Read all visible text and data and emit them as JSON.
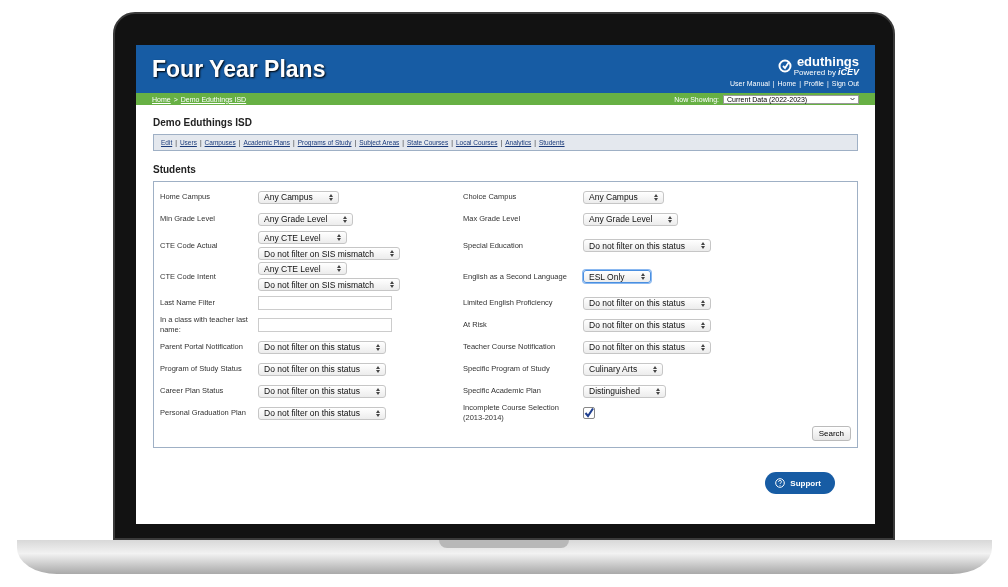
{
  "header": {
    "title": "Four Year Plans",
    "logo": {
      "name": "eduthings",
      "tagline": "Powered by",
      "brand": "iCEV"
    },
    "links_separator": "|",
    "links": [
      "User Manual",
      "Home",
      "Profile",
      "Sign Out"
    ]
  },
  "breadcrumb": {
    "separator": ">",
    "items": [
      "Home",
      "Demo Eduthings ISD"
    ]
  },
  "now_showing": {
    "label": "Now Showing:",
    "value": "Current Data (2022-2023)"
  },
  "district": "Demo Eduthings ISD",
  "nav": {
    "separator": "|",
    "links": [
      "Edit",
      "Users",
      "Campuses",
      "Academic Plans",
      "Programs of Study",
      "Subject Areas",
      "State Courses",
      "Local Courses",
      "Analytics",
      "Students"
    ]
  },
  "section_title": "Students",
  "filters": [
    {
      "left": {
        "label": "Home Campus",
        "kind": "select",
        "selects": [
          {
            "value": "Any Campus",
            "focused": false
          }
        ]
      },
      "right": {
        "label": "Choice Campus",
        "kind": "select",
        "selects": [
          {
            "value": "Any Campus",
            "focused": false
          }
        ]
      }
    },
    {
      "left": {
        "label": "Min Grade Level",
        "kind": "select",
        "selects": [
          {
            "value": "Any Grade Level",
            "focused": false
          }
        ]
      },
      "right": {
        "label": "Max Grade Level",
        "kind": "select",
        "selects": [
          {
            "value": "Any Grade Level",
            "focused": false
          }
        ]
      }
    },
    {
      "left": {
        "label": "CTE Code Actual",
        "kind": "select",
        "selects": [
          {
            "value": "Any CTE Level",
            "focused": false
          },
          {
            "value": "Do not filter on SIS mismatch",
            "focused": false
          }
        ]
      },
      "right": {
        "label": "Special Education",
        "kind": "select",
        "selects": [
          {
            "value": "Do not filter on this status",
            "focused": false
          }
        ]
      }
    },
    {
      "left": {
        "label": "CTE Code Intent",
        "kind": "select",
        "selects": [
          {
            "value": "Any CTE Level",
            "focused": false
          },
          {
            "value": "Do not filter on SIS mismatch",
            "focused": false
          }
        ]
      },
      "right": {
        "label": "English as a Second Language",
        "kind": "select",
        "selects": [
          {
            "value": "ESL Only",
            "focused": true
          }
        ]
      }
    },
    {
      "left": {
        "label": "Last Name Filter",
        "kind": "input"
      },
      "right": {
        "label": "Limited English Proficiency",
        "kind": "select",
        "selects": [
          {
            "value": "Do not filter on this status",
            "focused": false
          }
        ]
      }
    },
    {
      "left": {
        "label": "In a class with teacher last name:",
        "kind": "input"
      },
      "right": {
        "label": "At Risk",
        "kind": "select",
        "selects": [
          {
            "value": "Do not filter on this status",
            "focused": false
          }
        ]
      }
    },
    {
      "left": {
        "label": "Parent Portal Notification",
        "kind": "select",
        "selects": [
          {
            "value": "Do not filter on this status",
            "focused": false
          }
        ]
      },
      "right": {
        "label": "Teacher Course Notification",
        "kind": "select",
        "selects": [
          {
            "value": "Do not filter on this status",
            "focused": false
          }
        ]
      }
    },
    {
      "left": {
        "label": "Program of Study Status",
        "kind": "select",
        "selects": [
          {
            "value": "Do not filter on this status",
            "focused": false
          }
        ]
      },
      "right": {
        "label": "Specific Program of Study",
        "kind": "select",
        "selects": [
          {
            "value": "Culinary Arts",
            "focused": false
          }
        ]
      }
    },
    {
      "left": {
        "label": "Career Plan Status",
        "kind": "select",
        "selects": [
          {
            "value": "Do not filter on this status",
            "focused": false
          }
        ]
      },
      "right": {
        "label": "Specific Academic Plan",
        "kind": "select",
        "selects": [
          {
            "value": "Distinguished",
            "focused": false
          }
        ]
      }
    },
    {
      "left": {
        "label": "Personal Graduation Plan",
        "kind": "select",
        "selects": [
          {
            "value": "Do not filter on this status",
            "focused": false
          }
        ]
      },
      "right": {
        "label": "Incomplete Course Selection (2013-2014)",
        "kind": "checkbox",
        "checked": true
      }
    }
  ],
  "search_button": "Search",
  "support_button": "Support"
}
